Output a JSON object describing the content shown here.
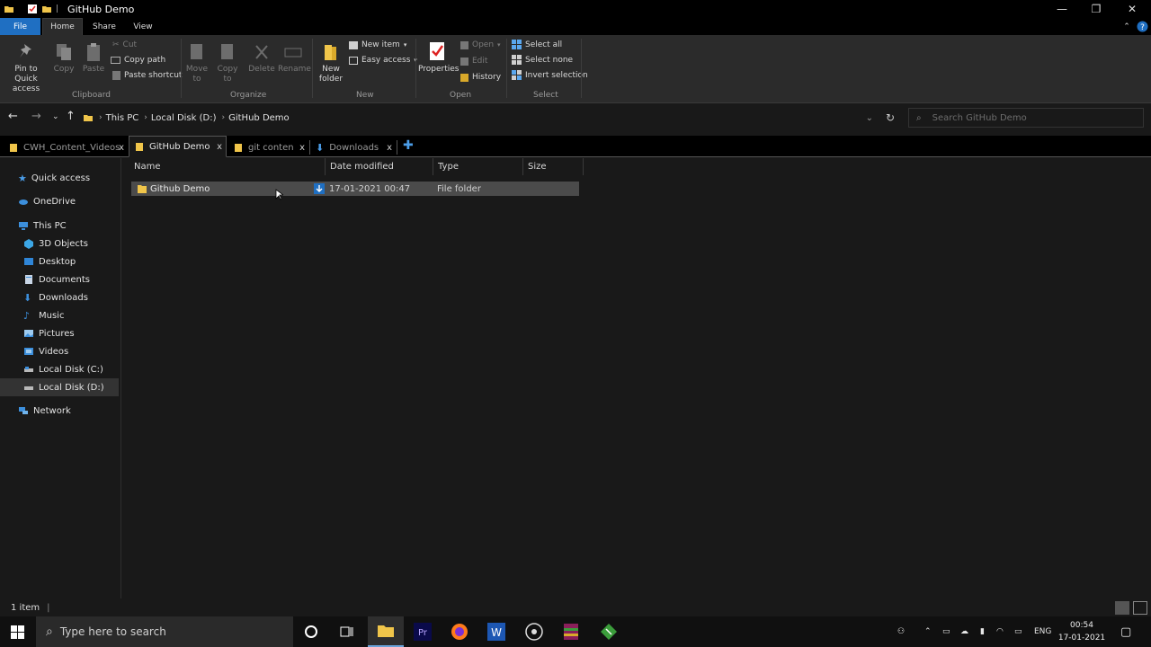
{
  "window": {
    "title": "GitHub Demo",
    "minimize_glyph": "—",
    "maximize_glyph": "❐",
    "close_glyph": "✕"
  },
  "ribbon_tabs": [
    "File",
    "Home",
    "Share",
    "View"
  ],
  "ribbon": {
    "clipboard": {
      "group": "Clipboard",
      "pin": "Pin to Quick access",
      "copy": "Copy",
      "paste": "Paste",
      "cut": "Cut",
      "copy_path": "Copy path",
      "paste_shortcut": "Paste shortcut"
    },
    "organize": {
      "group": "Organize",
      "move_to": "Move to",
      "copy_to": "Copy to",
      "delete": "Delete",
      "rename": "Rename"
    },
    "new": {
      "group": "New",
      "new_folder": "New folder",
      "new_item": "New item",
      "easy_access": "Easy access"
    },
    "open": {
      "group": "Open",
      "properties": "Properties",
      "open": "Open",
      "edit": "Edit",
      "history": "History"
    },
    "select": {
      "group": "Select",
      "select_all": "Select all",
      "select_none": "Select none",
      "invert": "Invert selection"
    }
  },
  "address": {
    "crumbs": [
      "This PC",
      "Local Disk (D:)",
      "GitHub Demo"
    ],
    "search_placeholder": "Search GitHub Demo"
  },
  "tabs": [
    {
      "label": "CWH_Content_Videos",
      "close": "x"
    },
    {
      "label": "GitHub Demo",
      "close": "x"
    },
    {
      "label": "git conten",
      "close": "x"
    },
    {
      "label": "Downloads",
      "close": "x"
    }
  ],
  "nav": {
    "quick_access": "Quick access",
    "onedrive": "OneDrive",
    "this_pc": "This PC",
    "objects3d": "3D Objects",
    "desktop": "Desktop",
    "documents": "Documents",
    "downloads": "Downloads",
    "music": "Music",
    "pictures": "Pictures",
    "videos": "Videos",
    "disk_c": "Local Disk (C:)",
    "disk_d": "Local Disk (D:)",
    "network": "Network"
  },
  "columns": [
    "Name",
    "Date modified",
    "Type",
    "Size"
  ],
  "files": [
    {
      "name": "Github Demo",
      "date": "17-01-2021 00:47",
      "type": "File folder",
      "size": ""
    }
  ],
  "status": {
    "count": "1 item"
  },
  "taskbar": {
    "search_placeholder": "Type here to search",
    "lang": "ENG",
    "time": "00:54",
    "date": "17-01-2021"
  },
  "colors": {
    "accent": "#1f6fc2",
    "folder": "#f0c54a",
    "selection": "#4b4b4b"
  }
}
